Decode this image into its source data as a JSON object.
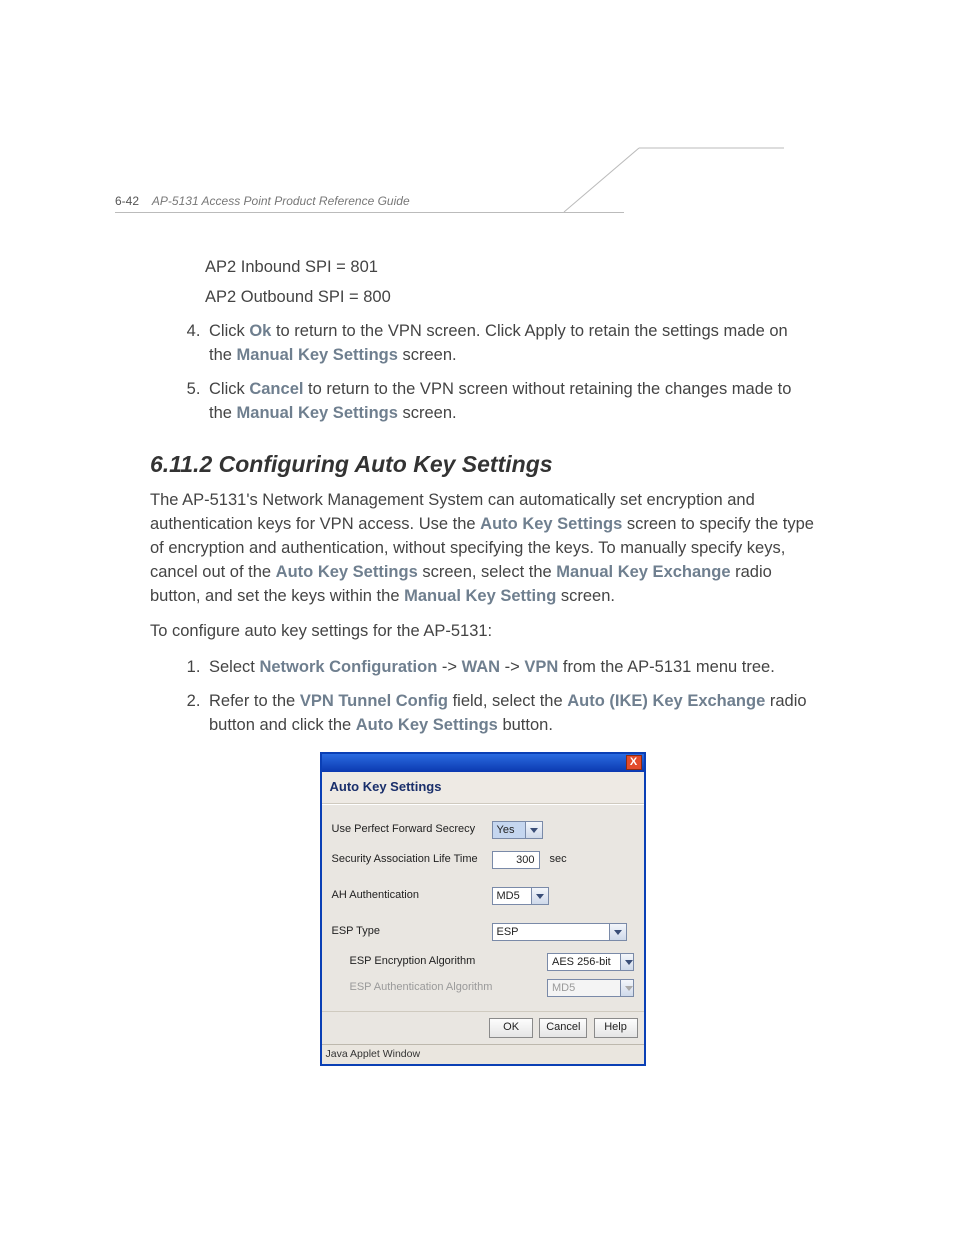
{
  "header": {
    "page_number": "6-42",
    "guide_title": "AP-5131 Access Point Product Reference Guide"
  },
  "upper": {
    "spi_line1": "AP2 Inbound SPI = 801",
    "spi_line2": "AP2 Outbound SPI = 800",
    "step4_num": "4",
    "step4_a": "Click ",
    "step4_ok": "Ok",
    "step4_b": " to return to the VPN screen. Click Apply to retain the settings made on the ",
    "step4_mks": "Manual Key Settings",
    "step4_c": " screen.",
    "step5_num": "5",
    "step5_a": "Click ",
    "step5_cancel": "Cancel",
    "step5_b": " to return to the VPN screen without retaining the changes made to the ",
    "step5_mks": "Manual Key Settings",
    "step5_c": " screen."
  },
  "section": {
    "number_title": "6.11.2  Configuring Auto Key Settings",
    "para1_a": "The AP-5131's Network Management System can automatically set encryption and authentication keys for VPN access. Use the ",
    "para1_aks": "Auto Key Settings",
    "para1_b": " screen to specify the type of encryption and authentication, without specifying the keys. To manually specify keys, cancel out of the ",
    "para1_aks2": "Auto Key Settings",
    "para1_c": " screen, select the ",
    "para1_mke": "Manual Key Exchange",
    "para1_d": " radio button, and set the keys within the ",
    "para1_mks": "Manual Key Setting",
    "para1_e": " screen.",
    "para2": "To configure auto key settings for the AP-5131:",
    "step1_a": "Select ",
    "step1_nc": "Network Configuration",
    "step1_arrow1": " -> ",
    "step1_wan": "WAN",
    "step1_arrow2": " -> ",
    "step1_vpn": "VPN",
    "step1_b": " from the AP-5131 menu tree.",
    "step2_a": "Refer to the ",
    "step2_vtc": "VPN Tunnel Config",
    "step2_b": " field, select the ",
    "step2_aike": "Auto (IKE) Key Exchange",
    "step2_c": " radio button and click the ",
    "step2_aks": "Auto Key Settings",
    "step2_d": " button."
  },
  "dialog": {
    "title": "Auto Key Settings",
    "close_glyph": "X",
    "labels": {
      "pfs": "Use Perfect Forward Secrecy",
      "salt": "Security Association Life Time",
      "ah": "AH Authentication",
      "esp_type": "ESP Type",
      "esp_enc": "ESP Encryption Algorithm",
      "esp_auth": "ESP Authentication Algorithm"
    },
    "values": {
      "pfs": "Yes",
      "salt": "300",
      "salt_unit": "sec",
      "ah": "MD5",
      "esp_type": "ESP",
      "esp_enc": "AES 256-bit",
      "esp_auth": "MD5"
    },
    "buttons": {
      "ok": "OK",
      "cancel": "Cancel",
      "help": "Help"
    },
    "status": "Java Applet Window"
  }
}
